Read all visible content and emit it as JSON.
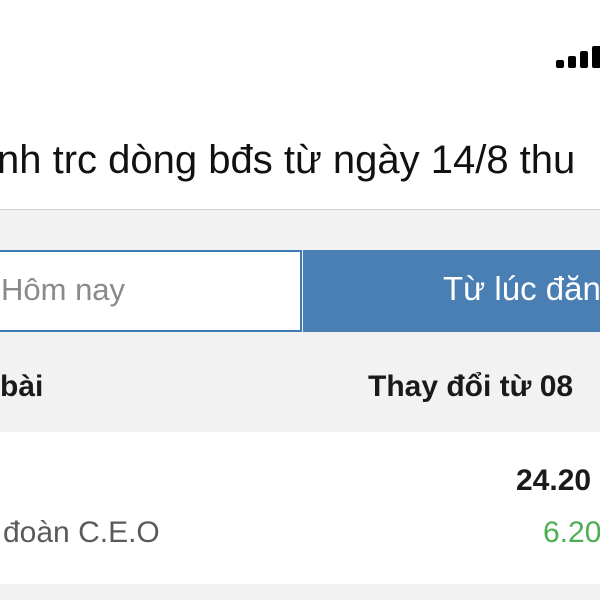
{
  "status_bar": {
    "signal_icon": "cellular-signal-icon"
  },
  "header": {
    "title": "nh trc dòng bđs từ ngày 14/8 thu"
  },
  "segmented_control": {
    "today_label": "Hôm nay",
    "since_label": "Từ lúc đăn",
    "active": "since"
  },
  "table": {
    "columns": {
      "post": "bài",
      "change": "Thay đổi từ 08"
    },
    "rows": [
      {
        "name": "đoàn C.E.O",
        "value": "24.20",
        "delta": "6.20",
        "delta_color": "#4caf50"
      }
    ]
  },
  "colors": {
    "accent": "#4a7fb4",
    "positive": "#4caf50",
    "band": "#f2f2f2"
  }
}
